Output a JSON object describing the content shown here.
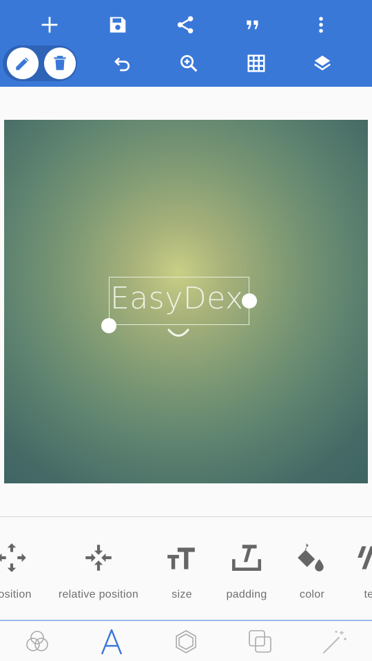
{
  "toolbar": {
    "row1": [
      {
        "icon": "add-icon"
      },
      {
        "icon": "save-icon"
      },
      {
        "icon": "share-icon"
      },
      {
        "icon": "quote-icon"
      },
      {
        "icon": "more-vert-icon"
      }
    ],
    "row2": [
      {
        "icon": "pencil-icon",
        "selected": true
      },
      {
        "icon": "trash-icon",
        "selected": true
      },
      {
        "icon": "undo-icon"
      },
      {
        "icon": "zoom-in-icon"
      },
      {
        "icon": "grid-icon"
      },
      {
        "icon": "layers-icon"
      }
    ],
    "accent_color": "#3a78d8"
  },
  "canvas": {
    "text": "EasyDex"
  },
  "options": {
    "items": [
      {
        "label": "position",
        "icon": "move-arrows-icon"
      },
      {
        "label": "relative position",
        "icon": "compress-arrows-icon"
      },
      {
        "label": "size",
        "icon": "text-size-icon"
      },
      {
        "label": "padding",
        "icon": "padding-icon"
      },
      {
        "label": "color",
        "icon": "paint-bucket-icon"
      },
      {
        "label": "text",
        "icon": "text-style-icon"
      }
    ]
  },
  "bottom_nav": {
    "items": [
      {
        "icon": "blend-circles-icon"
      },
      {
        "icon": "text-a-icon",
        "active": true
      },
      {
        "icon": "hexagon-icon"
      },
      {
        "icon": "overlap-squares-icon"
      },
      {
        "icon": "magic-wand-icon"
      }
    ],
    "active_color": "#3a78d8"
  }
}
